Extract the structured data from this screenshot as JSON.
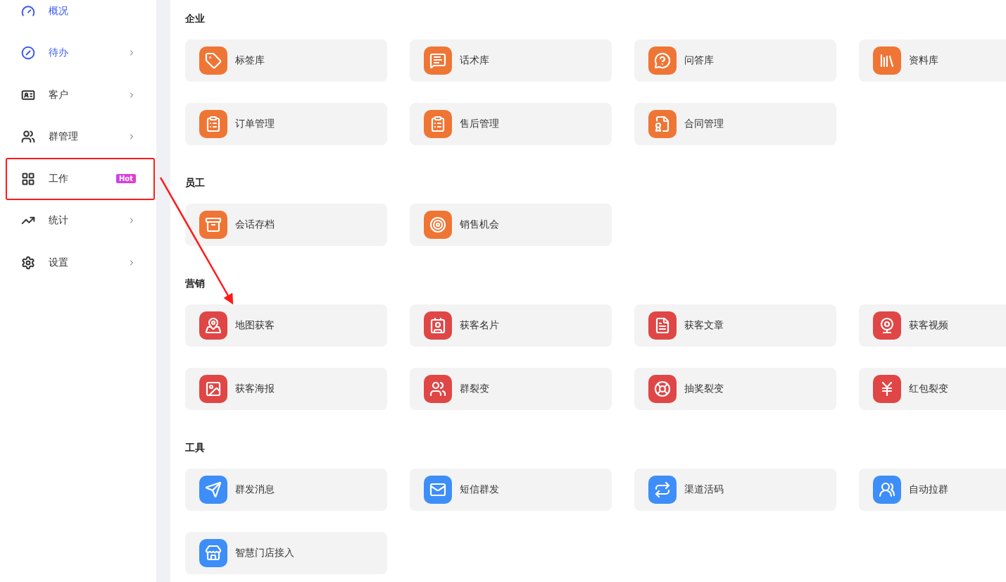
{
  "sidebar": {
    "items": [
      {
        "label": "概况",
        "highlighted": true,
        "selected": false,
        "expandable": false
      },
      {
        "label": "待办",
        "highlighted": true,
        "selected": false,
        "expandable": true
      },
      {
        "label": "客户",
        "highlighted": false,
        "selected": false,
        "expandable": true
      },
      {
        "label": "群管理",
        "highlighted": false,
        "selected": false,
        "expandable": true
      },
      {
        "label": "工作",
        "highlighted": false,
        "selected": true,
        "expandable": false,
        "badge": "Hot"
      },
      {
        "label": "统计",
        "highlighted": false,
        "selected": false,
        "expandable": true
      },
      {
        "label": "设置",
        "highlighted": false,
        "selected": false,
        "expandable": true
      }
    ]
  },
  "sections": [
    {
      "title": "企业",
      "color": "#ef7535",
      "items": [
        "标签库",
        "话术库",
        "问答库",
        "资料库",
        "订单管理",
        "售后管理",
        "合同管理"
      ]
    },
    {
      "title": "员工",
      "color": "#ef7535",
      "items": [
        "会话存档",
        "销售机会"
      ]
    },
    {
      "title": "营销",
      "color": "#e04646",
      "items": [
        "地图获客",
        "获客名片",
        "获客文章",
        "获客视频",
        "获客海报",
        "群裂变",
        "抽奖裂变",
        "红包裂变"
      ]
    },
    {
      "title": "工具",
      "color": "#3d8ef8",
      "items": [
        "群发消息",
        "短信群发",
        "渠道活码",
        "自动拉群",
        "智慧门店接入"
      ]
    }
  ]
}
